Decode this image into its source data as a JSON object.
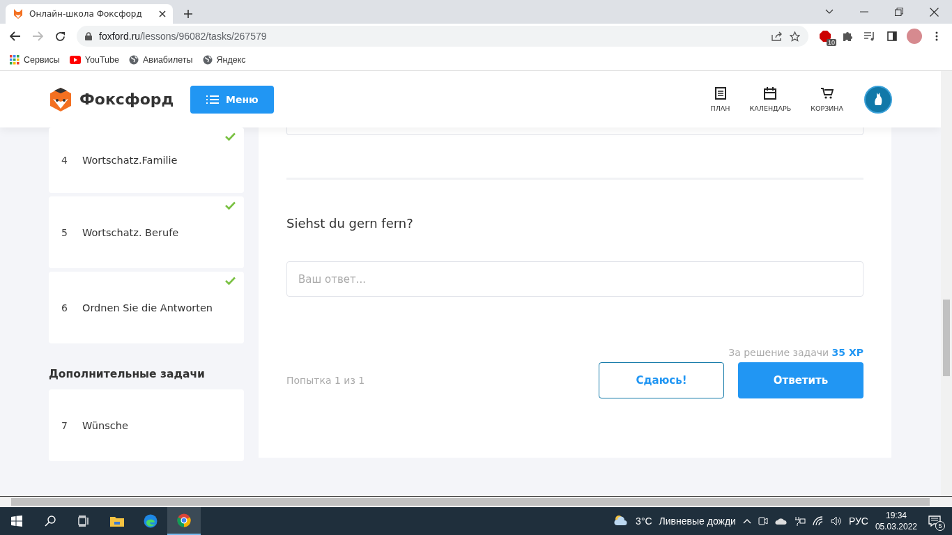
{
  "browser": {
    "tab_title": "Онлайн-школа Фоксфорд",
    "url_host": "foxford.ru",
    "url_path": "/lessons/96082/tasks/267579",
    "extension_badge": "10",
    "bookmarks": [
      {
        "label": "Сервисы",
        "kind": "apps"
      },
      {
        "label": "YouTube",
        "kind": "youtube"
      },
      {
        "label": "Авиабилеты",
        "kind": "globe"
      },
      {
        "label": "Яндекс",
        "kind": "globe"
      }
    ]
  },
  "header": {
    "logo": "Фоксфорд",
    "menu_button": "Меню",
    "nav": [
      {
        "label": "ПЛАН",
        "kind": "plan"
      },
      {
        "label": "КАЛЕНДАРЬ",
        "kind": "calendar"
      },
      {
        "label": "КОРЗИНА",
        "kind": "cart"
      }
    ]
  },
  "sidebar": {
    "tasks": [
      {
        "number": "4",
        "title": "Wortschatz.Familie",
        "done": true
      },
      {
        "number": "5",
        "title": "Wortschatz. Berufe",
        "done": true
      },
      {
        "number": "6",
        "title": "Ordnen Sie die Antworten",
        "done": true
      }
    ],
    "extra_heading": "Дополнительные задачи",
    "extra_tasks": [
      {
        "number": "7",
        "title": "Wünsche",
        "done": false
      }
    ]
  },
  "task": {
    "question": "Siehst du gern fern?",
    "answer_placeholder": "Ваш ответ...",
    "reward_label": "За решение задачи",
    "reward_value": "35 XP",
    "attempts": "Попытка 1 из 1",
    "give_up_button": "Сдаюсь!",
    "submit_button": "Ответить"
  },
  "taskbar": {
    "weather_temp": "3°C",
    "weather_text": "Ливневые дожди",
    "language": "РУС",
    "time": "19:34",
    "date": "05.03.2022",
    "notifications": "5"
  }
}
